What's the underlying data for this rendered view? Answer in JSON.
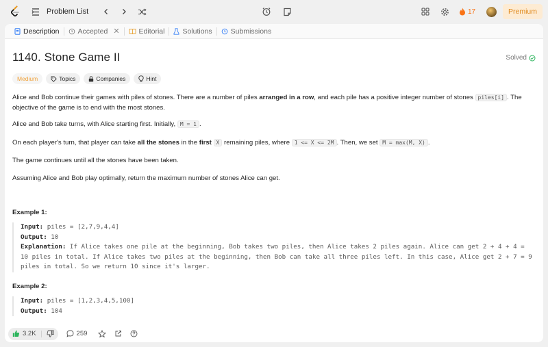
{
  "topbar": {
    "problem_list_label": "Problem List",
    "streak_count": "17",
    "premium_label": "Premium"
  },
  "tabs": [
    {
      "label": "Description"
    },
    {
      "label": "Accepted"
    },
    {
      "label": "Editorial"
    },
    {
      "label": "Solutions"
    },
    {
      "label": "Submissions"
    }
  ],
  "problem": {
    "title": "1140. Stone Game II",
    "solved_label": "Solved",
    "tags": [
      "Medium",
      "Topics",
      "Companies",
      "Hint"
    ]
  },
  "description": {
    "p1_a": "Alice and Bob continue their games with piles of stones.  There are a number of piles ",
    "p1_b": "arranged in a row",
    "p1_c": ", and each pile has a positive integer number of stones ",
    "p1_code": "piles[i]",
    "p1_d": ".  The objective of the game is to end with the most stones.",
    "p2_a": "Alice and Bob take turns, with Alice starting first.  Initially, ",
    "p2_code": "M = 1",
    "p2_b": ".",
    "p3_a": "On each player's turn, that player can take ",
    "p3_b": "all the stones",
    "p3_c": " in the ",
    "p3_d": "first",
    "p3_e": " ",
    "p3_code1": "X",
    "p3_f": " remaining piles, where ",
    "p3_code2": "1 <= X <= 2M",
    "p3_g": ".  Then, we set ",
    "p3_code3": "M = max(M, X)",
    "p3_h": ".",
    "p4": "The game continues until all the stones have been taken.",
    "p5": "Assuming Alice and Bob play optimally, return the maximum number of stones Alice can get."
  },
  "examples": [
    {
      "title": "Example 1:",
      "input_label": "Input:",
      "input": " piles = [2,7,9,4,4]",
      "output_label": "Output:",
      "output": " 10",
      "explanation_label": "Explanation:",
      "explanation": "  If Alice takes one pile at the beginning, Bob takes two piles, then Alice takes 2 piles again. Alice can get 2 + 4 + 4 = 10 piles in total. If Alice takes two piles at the beginning, then Bob can take all three piles left. In this case, Alice get 2 + 7 = 9 piles in total. So we return 10 since it's larger."
    },
    {
      "title": "Example 2:",
      "input_label": "Input:",
      "input": " piles = [1,2,3,4,5,100]",
      "output_label": "Output:",
      "output": " 104"
    }
  ],
  "footer": {
    "likes": "3.2K",
    "comments": "259"
  },
  "colors": {
    "accent_orange": "#f97316",
    "medium_tag": "#f0a23a",
    "solved_green": "#2db55d",
    "like_green": "#2db55d"
  }
}
